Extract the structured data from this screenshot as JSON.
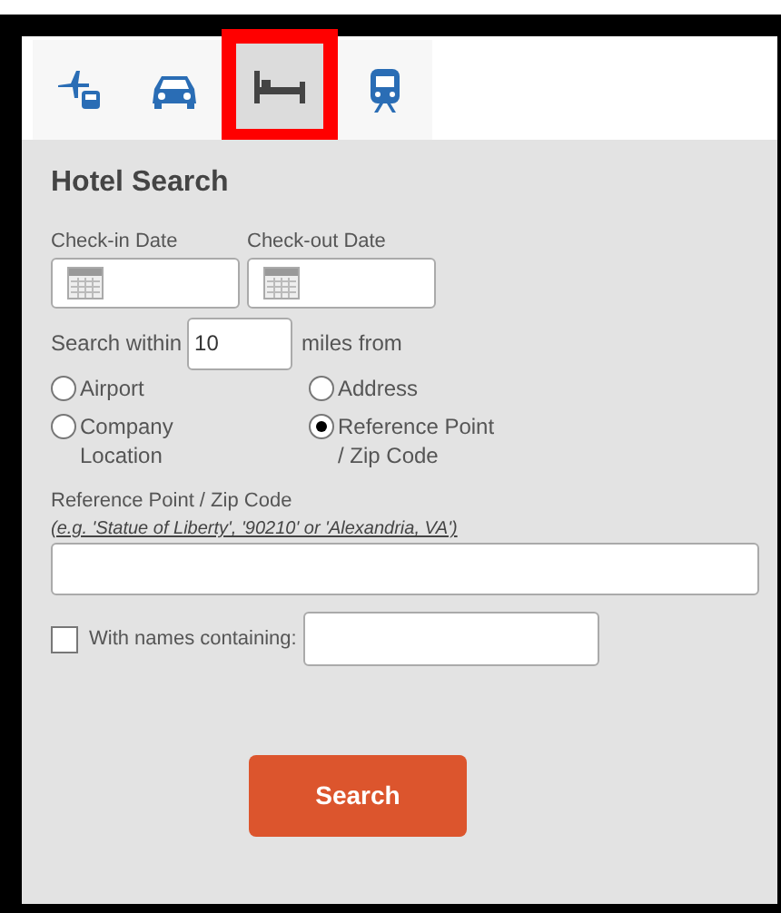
{
  "tabs": [
    {
      "kind": "flight-bus",
      "selected": false
    },
    {
      "kind": "car",
      "selected": false
    },
    {
      "kind": "hotel",
      "selected": true
    },
    {
      "kind": "train",
      "selected": false
    }
  ],
  "title": "Hotel Search",
  "dates": [
    {
      "label": "Check-in Date"
    },
    {
      "label": "Check-out Date"
    }
  ],
  "radius": {
    "prefix": "Search within",
    "value": "10",
    "suffix": "miles from"
  },
  "origin_options": [
    {
      "label": "Airport",
      "selected": false
    },
    {
      "label": "Address",
      "selected": false
    },
    {
      "label": "Company Location",
      "selected": false
    },
    {
      "label": "Reference Point / Zip Code",
      "selected": true
    }
  ],
  "reference": {
    "label": "Reference Point / Zip Code",
    "hint": "(e.g. 'Statue of Liberty', '90210' or 'Alexandria, VA')"
  },
  "name_filter": {
    "label": "With names containing:",
    "checked": false
  },
  "search_button": "Search"
}
